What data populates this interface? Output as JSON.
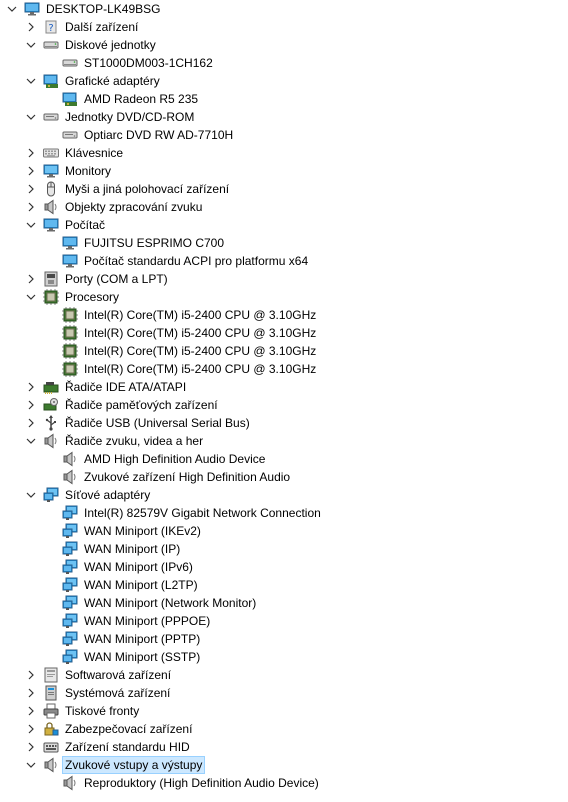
{
  "tree": [
    {
      "level": 0,
      "state": "expanded",
      "icon": "computer-icon",
      "label": "DESKTOP-LK49BSG"
    },
    {
      "level": 1,
      "state": "collapsed",
      "icon": "unknown-device-icon",
      "label": "Další zařízení"
    },
    {
      "level": 1,
      "state": "expanded",
      "icon": "disk-drive-icon",
      "label": "Diskové jednotky"
    },
    {
      "level": 2,
      "state": "leaf",
      "icon": "disk-drive-icon",
      "label": "ST1000DM003-1CH162"
    },
    {
      "level": 1,
      "state": "expanded",
      "icon": "display-adapter-icon",
      "label": "Grafické adaptéry"
    },
    {
      "level": 2,
      "state": "leaf",
      "icon": "display-adapter-icon",
      "label": "AMD Radeon R5 235"
    },
    {
      "level": 1,
      "state": "expanded",
      "icon": "dvd-drive-icon",
      "label": "Jednotky DVD/CD-ROM"
    },
    {
      "level": 2,
      "state": "leaf",
      "icon": "dvd-drive-icon",
      "label": "Optiarc DVD RW AD-7710H"
    },
    {
      "level": 1,
      "state": "collapsed",
      "icon": "keyboard-icon",
      "label": "Klávesnice"
    },
    {
      "level": 1,
      "state": "collapsed",
      "icon": "monitor-icon",
      "label": "Monitory"
    },
    {
      "level": 1,
      "state": "collapsed",
      "icon": "mouse-icon",
      "label": "Myši a jiná polohovací zařízení"
    },
    {
      "level": 1,
      "state": "collapsed",
      "icon": "speaker-icon",
      "label": "Objekty zpracování zvuku"
    },
    {
      "level": 1,
      "state": "expanded",
      "icon": "computer-icon",
      "label": "Počítač"
    },
    {
      "level": 2,
      "state": "leaf",
      "icon": "computer-icon",
      "label": "FUJITSU ESPRIMO C700"
    },
    {
      "level": 2,
      "state": "leaf",
      "icon": "computer-icon",
      "label": "Počítač standardu ACPI pro platformu x64"
    },
    {
      "level": 1,
      "state": "collapsed",
      "icon": "port-icon",
      "label": "Porty (COM a LPT)"
    },
    {
      "level": 1,
      "state": "expanded",
      "icon": "processor-icon",
      "label": "Procesory"
    },
    {
      "level": 2,
      "state": "leaf",
      "icon": "processor-icon",
      "label": "Intel(R) Core(TM) i5-2400 CPU @ 3.10GHz"
    },
    {
      "level": 2,
      "state": "leaf",
      "icon": "processor-icon",
      "label": "Intel(R) Core(TM) i5-2400 CPU @ 3.10GHz"
    },
    {
      "level": 2,
      "state": "leaf",
      "icon": "processor-icon",
      "label": "Intel(R) Core(TM) i5-2400 CPU @ 3.10GHz"
    },
    {
      "level": 2,
      "state": "leaf",
      "icon": "processor-icon",
      "label": "Intel(R) Core(TM) i5-2400 CPU @ 3.10GHz"
    },
    {
      "level": 1,
      "state": "collapsed",
      "icon": "ide-controller-icon",
      "label": "Řadiče IDE ATA/ATAPI"
    },
    {
      "level": 1,
      "state": "collapsed",
      "icon": "storage-controller-icon",
      "label": "Řadiče paměťových zařízení"
    },
    {
      "level": 1,
      "state": "collapsed",
      "icon": "usb-icon",
      "label": "Řadiče USB (Universal Serial Bus)"
    },
    {
      "level": 1,
      "state": "expanded",
      "icon": "speaker-icon",
      "label": "Řadiče zvuku, videa a her"
    },
    {
      "level": 2,
      "state": "leaf",
      "icon": "speaker-icon",
      "label": "AMD High Definition Audio Device"
    },
    {
      "level": 2,
      "state": "leaf",
      "icon": "speaker-icon",
      "label": "Zvukové zařízení High Definition Audio"
    },
    {
      "level": 1,
      "state": "expanded",
      "icon": "network-adapter-icon",
      "label": "Síťové adaptéry"
    },
    {
      "level": 2,
      "state": "leaf",
      "icon": "network-adapter-icon",
      "label": "Intel(R) 82579V Gigabit Network Connection"
    },
    {
      "level": 2,
      "state": "leaf",
      "icon": "network-adapter-icon",
      "label": "WAN Miniport (IKEv2)"
    },
    {
      "level": 2,
      "state": "leaf",
      "icon": "network-adapter-icon",
      "label": "WAN Miniport (IP)"
    },
    {
      "level": 2,
      "state": "leaf",
      "icon": "network-adapter-icon",
      "label": "WAN Miniport (IPv6)"
    },
    {
      "level": 2,
      "state": "leaf",
      "icon": "network-adapter-icon",
      "label": "WAN Miniport (L2TP)"
    },
    {
      "level": 2,
      "state": "leaf",
      "icon": "network-adapter-icon",
      "label": "WAN Miniport (Network Monitor)"
    },
    {
      "level": 2,
      "state": "leaf",
      "icon": "network-adapter-icon",
      "label": "WAN Miniport (PPPOE)"
    },
    {
      "level": 2,
      "state": "leaf",
      "icon": "network-adapter-icon",
      "label": "WAN Miniport (PPTP)"
    },
    {
      "level": 2,
      "state": "leaf",
      "icon": "network-adapter-icon",
      "label": "WAN Miniport (SSTP)"
    },
    {
      "level": 1,
      "state": "collapsed",
      "icon": "software-device-icon",
      "label": "Softwarová zařízení"
    },
    {
      "level": 1,
      "state": "collapsed",
      "icon": "system-device-icon",
      "label": "Systémová zařízení"
    },
    {
      "level": 1,
      "state": "collapsed",
      "icon": "printer-icon",
      "label": "Tiskové fronty"
    },
    {
      "level": 1,
      "state": "collapsed",
      "icon": "security-device-icon",
      "label": "Zabezpečovací zařízení"
    },
    {
      "level": 1,
      "state": "collapsed",
      "icon": "hid-icon",
      "label": "Zařízení standardu HID"
    },
    {
      "level": 1,
      "state": "expanded",
      "icon": "speaker-icon",
      "label": "Zvukové vstupy a výstupy",
      "selected": true
    },
    {
      "level": 2,
      "state": "leaf",
      "icon": "speaker-icon",
      "label": "Reproduktory (High Definition Audio Device)"
    }
  ],
  "colors": {
    "selection_bg": "#cce8ff",
    "selection_border": "#99d1ff",
    "monitor_blue": "#1a8fd8",
    "chip_green": "#3d7a2e",
    "chevron": "#333333"
  }
}
